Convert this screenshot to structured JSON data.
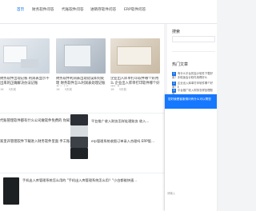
{
  "nav": [
    "首页",
    "财务软件问答",
    "代账软件问答",
    "进销存软件问答",
    "ERP软件问答"
  ],
  "cards": [
    {
      "title": "财务软件出现记账 利润表显示不出来的正确解决办法记账",
      "views": "16",
      "date": "3天前"
    },
    {
      "title": "财务软件利润表出现错误如何处理 财务软件怎么利润表处理记账怎么办？",
      "views": "16",
      "date": "3天前"
    },
    {
      "title": "企业出入库单打印软件哪个好用么 企业出入库单打印软件哪个好用？E",
      "views": "16",
      "date": "3天前"
    }
  ],
  "rows": [
    {
      "title": "代账管理软件都有什么公司做软件免费的 你知道么..."
    },
    {
      "title": "家里开管理软件下载进入财务软件里面 手工账..."
    }
  ],
  "right_list": [
    {
      "title": "平台推广收入财务怎样处理账务 收入..."
    },
    {
      "title": "erp管理系统收图订单录入合理吗 ERP管..."
    }
  ],
  "bottom": {
    "title": "手机出入库管理系统怎么用的 \"手机出入库管理系统怎么用？\"小白都能快速..."
  },
  "side": {
    "search_title": "搜索",
    "hot_title": "热门文章",
    "hot_items": [
      {
        "num": "1",
        "text": "有什么平台的会计软件下载好用？手机版会计软件用得好么"
      },
      {
        "num": "2",
        "text": "企业出入库单打印软件哪个好用？E"
      },
      {
        "num": "3",
        "text": "平台推广收入财务怎样处理账务"
      }
    ]
  },
  "chat": {
    "header": "您好我是客服请问有什么可以帮您",
    "placeholder": "请输入"
  }
}
